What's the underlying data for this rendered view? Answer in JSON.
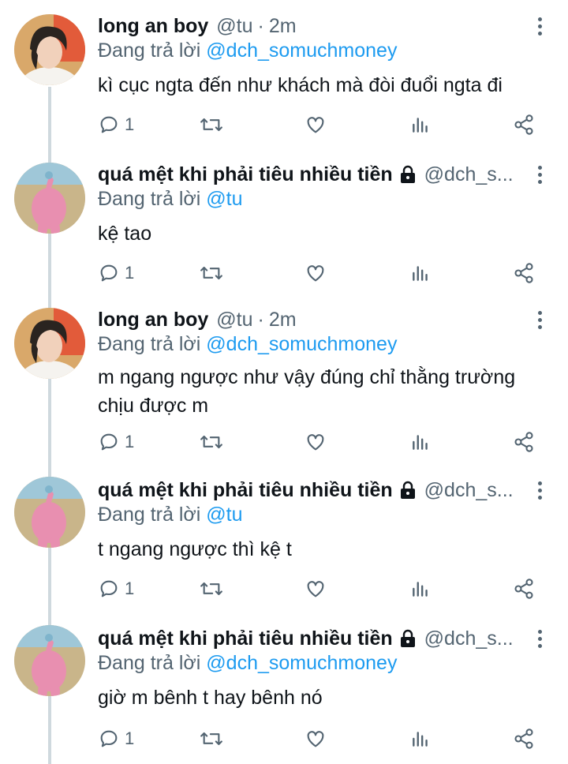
{
  "tweets": [
    {
      "name": "long an boy",
      "handle": "@tu",
      "separator": "·",
      "time": "2m",
      "locked": false,
      "reply_prefix": "Đang trả lời",
      "reply_to": "@dch_somuchmoney",
      "text": "kì cục ngta đến như khách mà đòi đuổi ngta đi",
      "reply_count": "1",
      "avatar": "boy-avatar"
    },
    {
      "name": "quá mệt khi phải tiêu nhiều tiền",
      "handle": "@dch_s...",
      "separator": "",
      "time": "",
      "locked": true,
      "reply_prefix": "Đang trả lời",
      "reply_to": "@tu",
      "text": "kệ tao",
      "reply_count": "1",
      "avatar": "pink-plush-avatar"
    },
    {
      "name": "long an boy",
      "handle": "@tu",
      "separator": "·",
      "time": "2m",
      "locked": false,
      "reply_prefix": "Đang trả lời",
      "reply_to": "@dch_somuchmoney",
      "text": "m ngang ngược như vậy đúng chỉ thằng trường chịu được m",
      "reply_count": "1",
      "avatar": "boy-avatar"
    },
    {
      "name": "quá mệt khi phải tiêu nhiều tiền",
      "handle": "@dch_s...",
      "separator": "",
      "time": "",
      "locked": true,
      "reply_prefix": "Đang trả lời",
      "reply_to": "@tu",
      "text": "t ngang ngược thì kệ t",
      "reply_count": "1",
      "avatar": "pink-plush-avatar"
    },
    {
      "name": "quá mệt khi phải tiêu nhiều tiền",
      "handle": "@dch_s...",
      "separator": "",
      "time": "",
      "locked": true,
      "reply_prefix": "Đang trả lời",
      "reply_to": "@dch_somuchmoney",
      "text": "giờ m bênh t hay bênh nó",
      "reply_count": "1",
      "avatar": "pink-plush-avatar"
    }
  ],
  "colors": {
    "link": "#1d9bf0",
    "secondary": "#536471",
    "primary_text": "#0f1419",
    "thread_line": "#cfd9de"
  },
  "icons": [
    "reply-icon",
    "retweet-icon",
    "like-icon",
    "analytics-icon",
    "share-icon",
    "more-icon",
    "lock-icon"
  ]
}
